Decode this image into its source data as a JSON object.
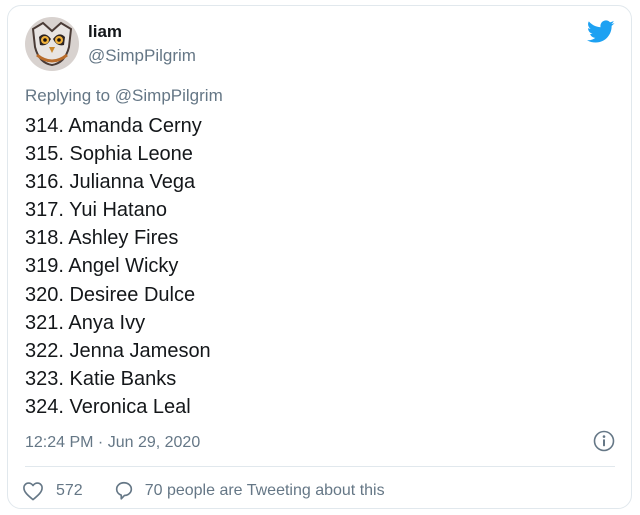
{
  "author": {
    "display_name": "liam",
    "handle": "@SimpPilgrim"
  },
  "reply": {
    "prefix": "Replying to",
    "mention": "@SimpPilgrim"
  },
  "tweet": {
    "lines": [
      "314. Amanda Cerny",
      "315. Sophia Leone",
      "316. Julianna Vega",
      "317. Yui Hatano",
      "318. Ashley Fires",
      "319. Angel Wicky",
      "320. Desiree Dulce",
      "321. Anya Ivy",
      "322. Jenna Jameson",
      "323. Katie Banks",
      "324. Veronica Leal"
    ],
    "timestamp": "12:24 PM · Jun 29, 2020"
  },
  "actions": {
    "like_count": "572",
    "comment_text": "70 people are Tweeting about this"
  },
  "icons": {
    "brand": "twitter-bird-icon",
    "info": "info-icon",
    "like": "heart-icon",
    "comment": "speech-bubble-icon"
  },
  "colors": {
    "brand_blue": "#1da1f2",
    "text": "#14171a",
    "secondary_text": "#657786",
    "border": "#e1e8ed"
  }
}
